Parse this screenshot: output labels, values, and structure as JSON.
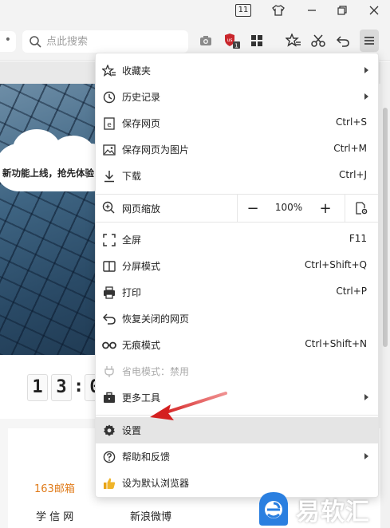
{
  "titlebar": {
    "tab_count": "11",
    "icons": [
      "tab-count-icon",
      "skin-tshirt-icon",
      "minimize-icon",
      "restore-icon",
      "close-icon"
    ]
  },
  "toolbar": {
    "nav_partial": "•",
    "search_placeholder": "点此搜索",
    "badge_count": "1",
    "icons": [
      "camera-icon",
      "shield-icon",
      "apps-grid-icon",
      "favorites-star-icon",
      "scissors-icon",
      "undo-icon",
      "menu-hamburger-icon"
    ]
  },
  "page": {
    "cloud_text": "新功能上线，抢先体验",
    "clock_digits": [
      "1",
      "3",
      ":",
      "0"
    ],
    "links": [
      "163邮箱",
      "学 信 网",
      "新浪微博"
    ]
  },
  "menu": {
    "items": [
      {
        "label": "收藏夹",
        "shortcut": "",
        "submenu": true,
        "icon": "favorites-star-icon"
      },
      {
        "label": "历史记录",
        "shortcut": "",
        "submenu": true,
        "icon": "history-clock-icon"
      },
      {
        "label": "保存网页",
        "shortcut": "Ctrl+S",
        "submenu": false,
        "icon": "save-page-icon"
      },
      {
        "label": "保存网页为图片",
        "shortcut": "Ctrl+M",
        "submenu": false,
        "icon": "save-image-icon"
      },
      {
        "label": "下载",
        "shortcut": "Ctrl+J",
        "submenu": false,
        "icon": "download-icon"
      }
    ],
    "zoom": {
      "label": "网页缩放",
      "minus": "−",
      "value": "100%",
      "plus": "+",
      "icon": "zoom-icon"
    },
    "items2": [
      {
        "label": "全屏",
        "shortcut": "F11",
        "submenu": false,
        "icon": "fullscreen-icon"
      },
      {
        "label": "分屏模式",
        "shortcut": "Ctrl+Shift+Q",
        "submenu": false,
        "icon": "split-screen-icon"
      },
      {
        "label": "打印",
        "shortcut": "Ctrl+P",
        "submenu": false,
        "icon": "printer-icon"
      },
      {
        "label": "恢复关闭的网页",
        "shortcut": "",
        "submenu": false,
        "icon": "restore-tab-icon"
      },
      {
        "label": "无痕模式",
        "shortcut": "Ctrl+Shift+N",
        "submenu": false,
        "icon": "incognito-icon"
      },
      {
        "label": "省电模式：禁用",
        "shortcut": "",
        "submenu": false,
        "disabled": true,
        "icon": "power-save-icon"
      },
      {
        "label": "更多工具",
        "shortcut": "",
        "submenu": true,
        "icon": "toolbox-icon"
      }
    ],
    "items3": [
      {
        "label": "设置",
        "shortcut": "",
        "submenu": false,
        "active": true,
        "icon": "settings-gear-icon"
      },
      {
        "label": "帮助和反馈",
        "shortcut": "",
        "submenu": true,
        "icon": "help-icon"
      },
      {
        "label": "设为默认浏览器",
        "shortcut": "",
        "submenu": false,
        "icon": "thumbs-up-icon"
      }
    ]
  },
  "watermark": {
    "text": "易软汇",
    "icon": "watermark-logo-icon"
  },
  "colors": {
    "annotation_arrow": "#d42020",
    "highlight_link": "#e07b1a",
    "watermark_blue": "#2a7fe0"
  }
}
